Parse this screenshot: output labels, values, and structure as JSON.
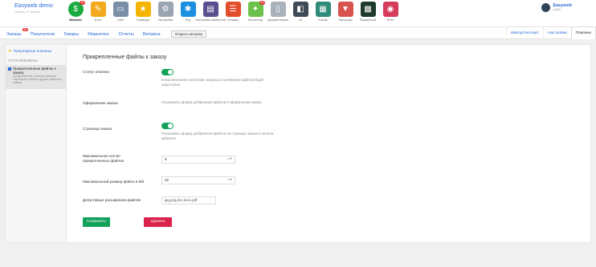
{
  "brand": {
    "name": "Easyweb demo",
    "date": "Четверг, 27 апреля"
  },
  "apps": [
    {
      "label": "Магазин",
      "icon": "dollar-icon",
      "color": "#1aab3f",
      "glyph": "$",
      "badge": "18",
      "active": true
    },
    {
      "label": "Блог",
      "icon": "pencil-icon",
      "color": "#f2a91d",
      "glyph": "✎",
      "badge": "",
      "active": false
    },
    {
      "label": "Сайт",
      "icon": "site-icon",
      "color": "#7a8ea8",
      "glyph": "▭",
      "badge": "",
      "active": false
    },
    {
      "label": "Команда",
      "icon": "star-icon",
      "color": "#f5b400",
      "glyph": "★",
      "badge": "",
      "active": false
    },
    {
      "label": "Настройки",
      "icon": "gear-icon",
      "color": "#9aa5b1",
      "glyph": "⚙",
      "badge": "",
      "active": false
    },
    {
      "label": "Ясу",
      "icon": "asterisk-icon",
      "color": "#1d8fe0",
      "glyph": "✱",
      "badge": "",
      "active": false
    },
    {
      "label": "Настройки шаблонов",
      "icon": "template-icon",
      "color": "#5c4f8f",
      "glyph": "▤",
      "badge": "",
      "active": false
    },
    {
      "label": "Отзывы",
      "icon": "reviews-icon",
      "color": "#e34e2d",
      "glyph": "☰",
      "badge": "",
      "active": false
    },
    {
      "label": "Инспектор",
      "icon": "wand-icon",
      "color": "#6cc24a",
      "glyph": "✦",
      "badge": "19",
      "active": false
    },
    {
      "label": "Документация",
      "icon": "docs-icon",
      "color": "#a9b2bb",
      "glyph": "▯",
      "badge": "",
      "active": false
    },
    {
      "label": "UI",
      "icon": "ui-icon",
      "color": "#3e4b57",
      "glyph": "◧",
      "badge": "",
      "active": false
    },
    {
      "label": "Easufy",
      "icon": "easufy-icon",
      "color": "#2e8b7a",
      "glyph": "▦",
      "badge": "",
      "active": false
    },
    {
      "label": "Рассылки",
      "icon": "mailer-icon",
      "color": "#d9534f",
      "glyph": "▼",
      "badge": "",
      "active": false
    },
    {
      "label": "Разработка",
      "icon": "dev-icon",
      "color": "#1d3a2b",
      "glyph": "▩",
      "badge": "",
      "active": false
    },
    {
      "label": "Фото",
      "icon": "photo-icon",
      "color": "#d63b5b",
      "glyph": "◉",
      "badge": "",
      "active": false
    }
  ],
  "user": {
    "name": "Easyweb",
    "role": "public"
  },
  "nav": {
    "items": [
      "Заказы",
      "Покупатели",
      "Товары",
      "Маркетинг",
      "Отчеты",
      "Витрина"
    ],
    "orders_badge": "18",
    "open_store": "Открыть витрину",
    "right_tabs": [
      "Импорт/экспорт",
      "Настройки",
      "Плагины"
    ]
  },
  "sidebar": {
    "popular": "Популярные плагины",
    "installed_heading": "Установлены",
    "item_title": "Прикрепленные файлы к заказу",
    "item_desc": "Прикрепление к заказу файлов, чертежей и любых других файлов к заказу"
  },
  "form": {
    "title": "Прикрепленные файлы к заказу",
    "status_label": "Статус плагина",
    "status_hint": "В выключенном состоянии загрузка и скачивание файлов будет недоступна",
    "order_design_label": "Оформление заказа",
    "order_design_hint": "Показывать форму добавления файлов в оформлении заказа",
    "order_page_label": "Страница заказа",
    "order_page_hint": "Показывать форму добавления файлов на странице заказа в личном кабинете",
    "max_files_label": "Максимальное кол-во прикрепленных файлов",
    "max_files_value": "5",
    "max_size_label": "Максимальный размер файла в Мб",
    "max_size_value": "32",
    "extensions_label": "Допустимые расширения файлов",
    "extensions_value": "jpg,png,doc,docx,pdf",
    "save_button": "Сохранить настройки",
    "delete_button": "Удалить временные файлы",
    "stepper_glyph": "−+"
  },
  "colors": {
    "accent": "#2a6ad8",
    "toggle": "#12a15a",
    "save": "#12a15a",
    "delete": "#d9234b"
  }
}
